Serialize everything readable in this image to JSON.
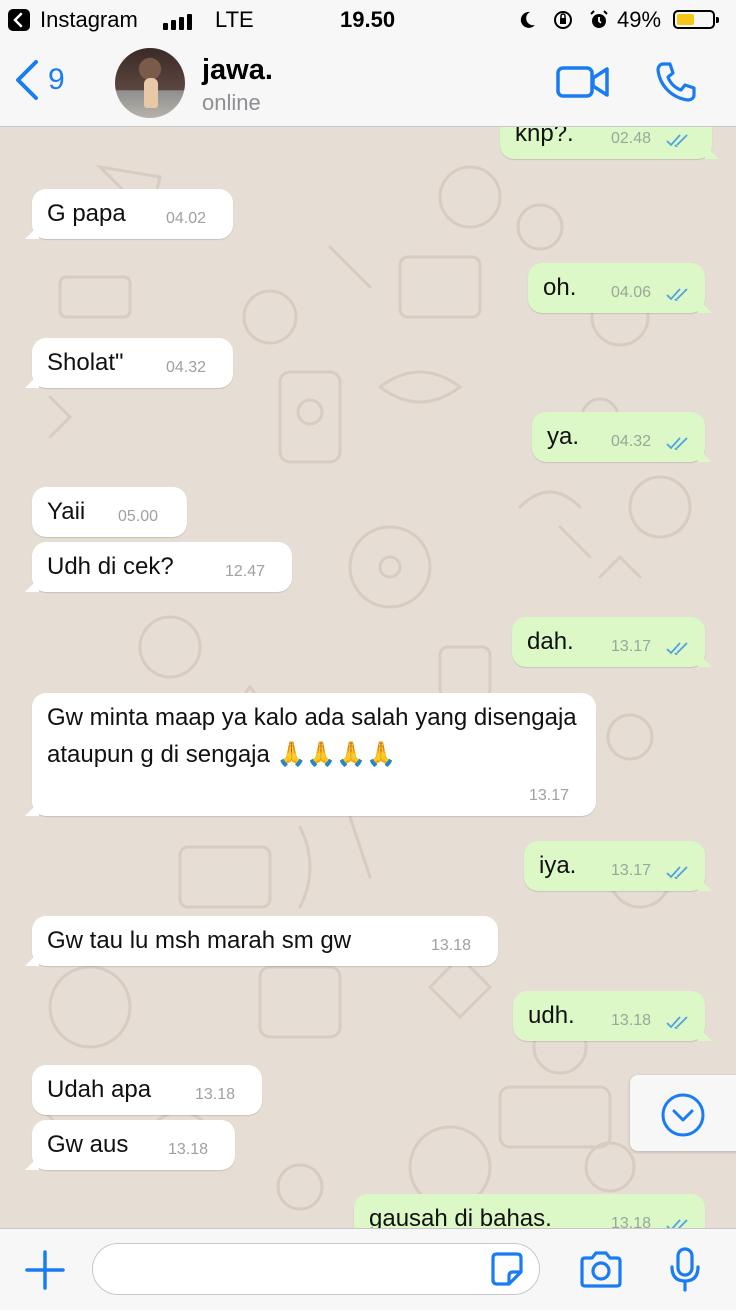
{
  "status_bar": {
    "back_app": "Instagram",
    "network": "LTE",
    "time": "19.50",
    "battery": "49%",
    "battery_level": 0.49
  },
  "header": {
    "back_count": "9",
    "contact_name": "jawa.",
    "contact_status": "online"
  },
  "messages": [
    {
      "dir": "out",
      "text": "knp?.",
      "time": "02.48"
    },
    {
      "dir": "in",
      "text": "G papa",
      "time": "04.02"
    },
    {
      "dir": "out",
      "text": "oh.",
      "time": "04.06"
    },
    {
      "dir": "in",
      "text": "Sholat\"",
      "time": "04.32"
    },
    {
      "dir": "out",
      "text": "ya.",
      "time": "04.32"
    },
    {
      "dir": "in",
      "text": "Yaii",
      "time": "05.00"
    },
    {
      "dir": "in",
      "text": "Udh di cek?",
      "time": "12.47"
    },
    {
      "dir": "out",
      "text": "dah.",
      "time": "13.17"
    },
    {
      "dir": "in",
      "text": "Gw minta maap ya kalo ada salah yang disengaja ataupun g di sengaja 🙏🙏🙏🙏",
      "time": "13.17"
    },
    {
      "dir": "out",
      "text": "iya.",
      "time": "13.17"
    },
    {
      "dir": "in",
      "text": "Gw tau lu msh marah sm gw",
      "time": "13.18"
    },
    {
      "dir": "out",
      "text": "udh.",
      "time": "13.18"
    },
    {
      "dir": "in",
      "text": "Udah apa",
      "time": "13.18"
    },
    {
      "dir": "in",
      "text": "Gw aus",
      "time": "13.18"
    },
    {
      "dir": "out",
      "text": "gausah di bahas.",
      "time": "13.18"
    }
  ],
  "input": {
    "placeholder": ""
  },
  "colors": {
    "accent": "#1a7cf2",
    "outgoing_bubble": "#dcf8c6",
    "incoming_bubble": "#ffffff",
    "chat_background": "#e6ddd4",
    "read_ticks": "#4fa3e0"
  }
}
